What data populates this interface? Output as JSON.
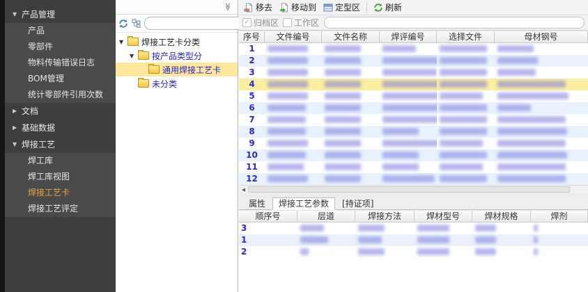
{
  "icons": {
    "collapse_chevrons": "≫",
    "expanded_arrow": "▼",
    "collapsed_arrow": "▶",
    "check_mark": "✓",
    "scroll_left_arrow": "◀",
    "search_down_arrow": "▼",
    "search_up_arrow": "▲"
  },
  "sidebar": {
    "sections": [
      {
        "label": "产品管理",
        "expanded": true,
        "children": [
          {
            "label": "产品"
          },
          {
            "label": "零部件"
          },
          {
            "label": "物料传输错误日志"
          },
          {
            "label": "BOM管理"
          },
          {
            "label": "统计零部件引用次数"
          }
        ]
      },
      {
        "label": "文档",
        "expanded": false,
        "children": []
      },
      {
        "label": "基础数据",
        "expanded": false,
        "children": []
      },
      {
        "label": "焊接工艺",
        "expanded": true,
        "children": [
          {
            "label": "焊工库"
          },
          {
            "label": "焊工库视图"
          },
          {
            "label": "焊接工艺卡",
            "active": true
          },
          {
            "label": "焊接工艺评定"
          }
        ]
      }
    ]
  },
  "tree_panel": {
    "search_value": "",
    "nodes": [
      {
        "label": "焊接工艺卡分类",
        "level": 0,
        "expanded": true,
        "root": true
      },
      {
        "label": "按产品类型分",
        "level": 1,
        "expanded": true
      },
      {
        "label": "通用焊接工艺卡",
        "level": 2,
        "selected": true
      },
      {
        "label": "未分类",
        "level": 1
      }
    ]
  },
  "main_panel": {
    "toolbar": {
      "buttons": [
        {
          "label": "移去",
          "icon": "page-remove-icon"
        },
        {
          "label": "移动到",
          "icon": "page-move-icon"
        },
        {
          "label": "定型区",
          "icon": "fixed-area-icon"
        },
        {
          "label": "刷新",
          "icon": "refresh-icon"
        }
      ]
    },
    "filter": {
      "checkboxes": [
        {
          "label": "归档区",
          "checked": true
        },
        {
          "label": "工作区",
          "checked": false
        }
      ],
      "search_value": ""
    },
    "table": {
      "columns": [
        "序号",
        "文件编号",
        "文件名称",
        "焊评编号",
        "选择文件",
        "母材钢号"
      ],
      "selected_row": "4",
      "rows": [
        {
          "num": "1",
          "redacted_cells": [
            58,
            52,
            48,
            68,
            52
          ]
        },
        {
          "num": "2",
          "redacted_cells": [
            58,
            52,
            88,
            68,
            58
          ]
        },
        {
          "num": "3",
          "redacted_cells": [
            58,
            52,
            78,
            68,
            55
          ]
        },
        {
          "num": "4",
          "redacted_cells": [
            58,
            52,
            85,
            68,
            98
          ]
        },
        {
          "num": "5",
          "redacted_cells": [
            58,
            52,
            85,
            62,
            102
          ]
        },
        {
          "num": "6",
          "redacted_cells": [
            55,
            52,
            100,
            68,
            48
          ]
        },
        {
          "num": "7",
          "redacted_cells": [
            55,
            52,
            88,
            68,
            98
          ]
        },
        {
          "num": "8",
          "redacted_cells": [
            55,
            52,
            52,
            68,
            100
          ]
        },
        {
          "num": "9",
          "redacted_cells": [
            58,
            52,
            85,
            62,
            98
          ]
        },
        {
          "num": "10",
          "redacted_cells": [
            55,
            52,
            52,
            68,
            100
          ]
        },
        {
          "num": "11",
          "redacted_cells": [
            52,
            52,
            52,
            62,
            98
          ]
        },
        {
          "num": "12",
          "redacted_cells": [
            58,
            52,
            75,
            68,
            98
          ]
        }
      ]
    },
    "bottom": {
      "tabs": [
        {
          "label": "属性"
        },
        {
          "label": "焊接工艺参数",
          "active": true
        },
        {
          "label": "[持证项]"
        }
      ],
      "columns": [
        "顺序号",
        "层道",
        "焊接方法",
        "焊材型号",
        "焊材规格",
        "焊剂"
      ],
      "rows": [
        {
          "num": "3",
          "redacted_cells": [
            34,
            38,
            46,
            30,
            6
          ]
        },
        {
          "num": "1",
          "redacted_cells": [
            40,
            34,
            46,
            30,
            6
          ]
        },
        {
          "num": "2",
          "redacted_cells": [
            12,
            38,
            46,
            30,
            6
          ]
        }
      ]
    }
  }
}
